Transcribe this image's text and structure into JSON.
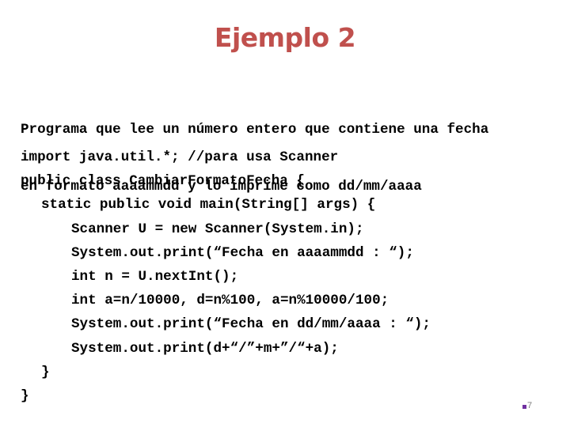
{
  "slide": {
    "title": "Ejemplo 2",
    "description_lines": [
      "Programa que lee un número entero que contiene una fecha",
      "en formato aaaammdd y lo imprime como dd/mm/aaaa"
    ],
    "code_lines": [
      {
        "indent": 0,
        "text": "import java.util.*; //para usa Scanner"
      },
      {
        "indent": 0,
        "text": "public class CambiarFormatoFecha {"
      },
      {
        "indent": 1,
        "text": "static public void main(String[] args) {"
      },
      {
        "indent": 2,
        "text": "Scanner U = new Scanner(System.in);"
      },
      {
        "indent": 2,
        "text": "System.out.print(“Fecha en aaaammdd : “);"
      },
      {
        "indent": 2,
        "text": "int n = U.nextInt();"
      },
      {
        "indent": 2,
        "text": "int a=n/10000, d=n%100, a=n%10000/100;"
      },
      {
        "indent": 2,
        "text": "System.out.print(“Fecha en dd/mm/aaaa : “);"
      },
      {
        "indent": 2,
        "text": "System.out.print(d+“/”+m+”/“+a);"
      },
      {
        "indent": 1,
        "text": "}"
      },
      {
        "indent": 0,
        "text": "}"
      }
    ],
    "page_number": "7",
    "colors": {
      "title": "#C0504D",
      "bullet": "#7030A0",
      "page_number": "#7F7F7F"
    }
  }
}
